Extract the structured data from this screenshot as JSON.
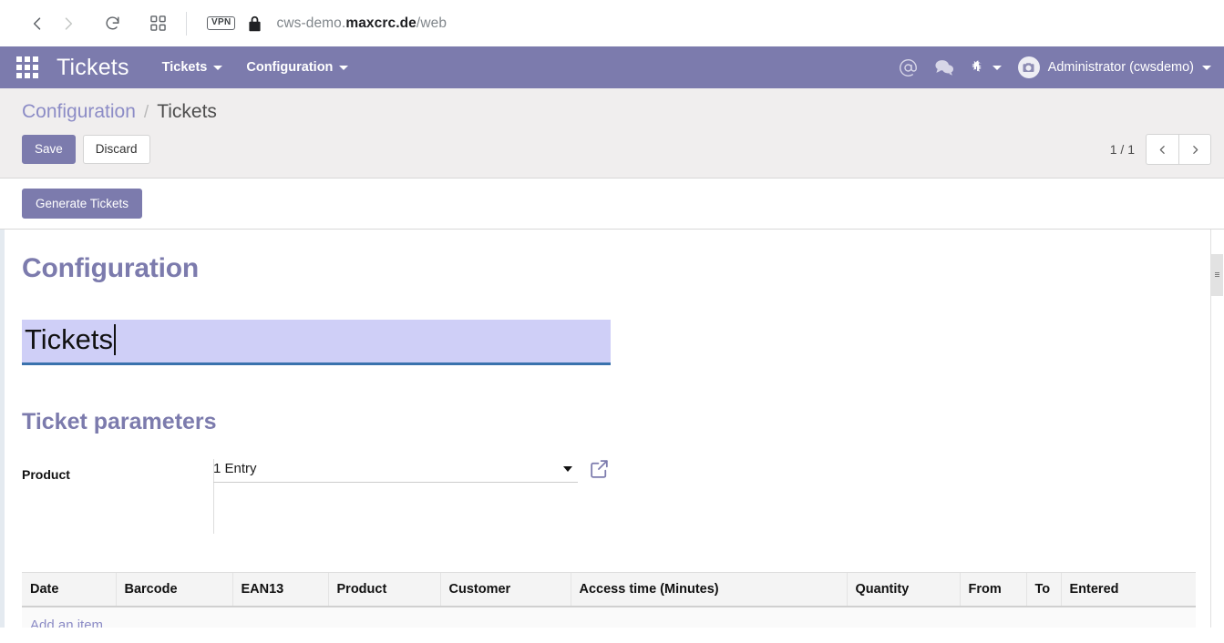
{
  "browser": {
    "back_icon": "chevron-left-icon",
    "forward_icon": "chevron-right-icon",
    "reload_icon": "reload-icon",
    "tabs_icon": "grid-tabs-icon",
    "vpn_label": "VPN",
    "lock_icon": "lock-icon",
    "url_prefix": "cws-demo.",
    "url_host": "maxcrc.de",
    "url_path": "/web"
  },
  "navbar": {
    "apps_icon": "apps-grid-icon",
    "brand": "Tickets",
    "menus": [
      {
        "label": "Tickets"
      },
      {
        "label": "Configuration"
      }
    ],
    "mention_icon": "at-mention-icon",
    "messages_icon": "chat-bubble-icon",
    "debug_icon": "bug-icon",
    "avatar_icon": "user-avatar-icon",
    "user_label": "Administrator (cwsdemo)",
    "background_color": "#7C7BAD"
  },
  "control_panel": {
    "breadcrumb": {
      "parent": "Configuration",
      "separator": "/",
      "current": "Tickets"
    },
    "save_label": "Save",
    "discard_label": "Discard",
    "pager": {
      "count": "1 / 1",
      "prev_icon": "chevron-left-icon",
      "next_icon": "chevron-right-icon"
    }
  },
  "statusbar": {
    "generate_label": "Generate Tickets"
  },
  "form": {
    "title": "Configuration",
    "name_value": "Tickets",
    "name_placeholder": "",
    "group_title": "Ticket parameters",
    "product": {
      "label": "Product",
      "value": "1 Entry",
      "dropdown_icon": "chevron-down-icon",
      "external_link_icon": "external-link-icon"
    }
  },
  "tickets_table": {
    "columns": [
      "Date",
      "Barcode",
      "EAN13",
      "Product",
      "Customer",
      "Access time (Minutes)",
      "Quantity",
      "From",
      "To",
      "Entered"
    ],
    "rows": [],
    "add_item_label": "Add an item"
  },
  "scrollbar": {
    "thumb_grip_icon": "scroll-grip-icon"
  }
}
